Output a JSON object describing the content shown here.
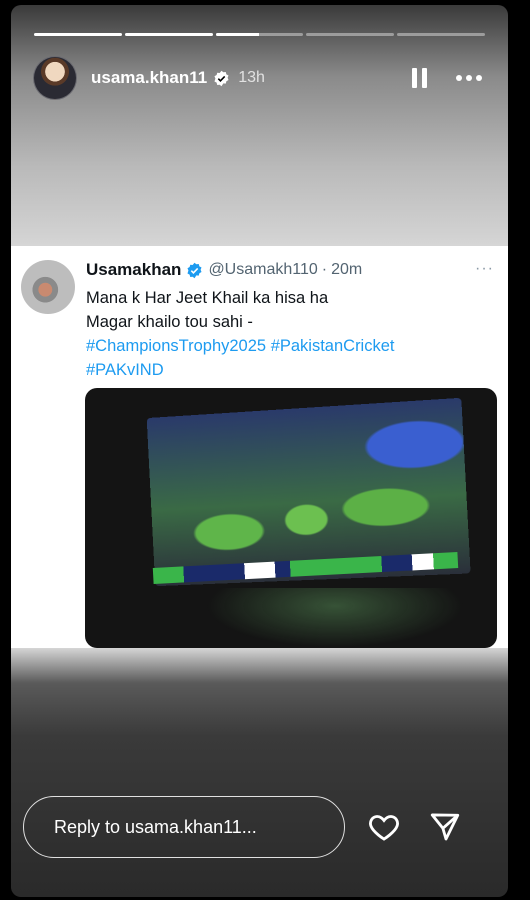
{
  "story": {
    "progress": [
      1,
      1,
      0.5,
      0,
      0
    ],
    "username": "usama.khan11",
    "time": "13h",
    "icons": {
      "verified": "verified-badge-icon",
      "pause": "pause-icon",
      "more": "more-icon",
      "heart": "heart-icon",
      "send": "send-icon"
    }
  },
  "tweet": {
    "name": "Usamakhan",
    "handle": "@Usamakh110",
    "dot": "·",
    "time": "20m",
    "more": "···",
    "line1": "Mana k Har Jeet Khail ka hisa ha",
    "line2": "Magar khailo tou sahi -",
    "tag1": "#ChampionsTrophy2025",
    "tag2": "#PakistanCricket",
    "tag3": "#PAKvIND"
  },
  "reply": {
    "placeholder": "Reply to usama.khan11..."
  },
  "colors": {
    "link": "#1d9bf0",
    "verified": "#1d9bf0"
  }
}
